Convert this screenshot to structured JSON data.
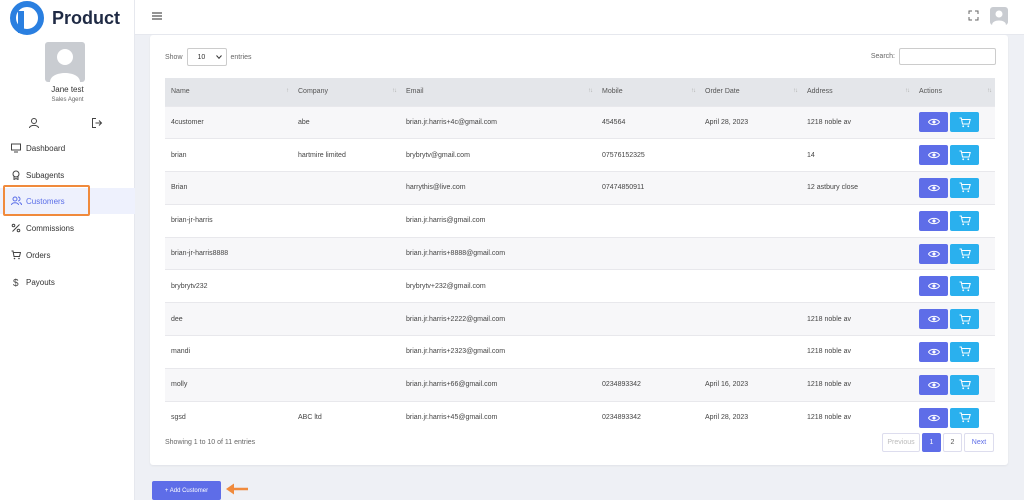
{
  "brand": {
    "name": "Product",
    "color": "#2a7fe0"
  },
  "user": {
    "name": "Jane test",
    "role": "Sales Agent"
  },
  "nav": [
    {
      "label": "Dashboard",
      "icon": "monitor-icon"
    },
    {
      "label": "Subagents",
      "icon": "badge-icon"
    },
    {
      "label": "Customers",
      "icon": "users-icon",
      "active": true
    },
    {
      "label": "Commissions",
      "icon": "percent-icon"
    },
    {
      "label": "Orders",
      "icon": "cart-icon"
    },
    {
      "label": "Payouts",
      "icon": "dollar-icon"
    }
  ],
  "controls": {
    "show_label": "Show",
    "page_length": "10",
    "entries_label": "entries",
    "search_label": "Search:",
    "search_value": ""
  },
  "table": {
    "columns": [
      "Name",
      "Company",
      "Email",
      "Mobile",
      "Order Date",
      "Address",
      "Actions"
    ],
    "rows": [
      [
        "4customer",
        "abe",
        "brian.jr.harris+4c@gmail.com",
        "454564",
        "April 28, 2023",
        "1218 noble av"
      ],
      [
        "brian",
        "hartmire limited",
        "brybrytv@gmail.com",
        "07576152325",
        "",
        "14"
      ],
      [
        "Brian",
        "",
        "harrythis@live.com",
        "07474850911",
        "",
        "12 astbury close"
      ],
      [
        "brian-jr-harris",
        "",
        "brian.jr.harris@gmail.com",
        "",
        "",
        ""
      ],
      [
        "brian-jr-harris8888",
        "",
        "brian.jr.harris+8888@gmail.com",
        "",
        "",
        ""
      ],
      [
        "brybrytv232",
        "",
        "brybrytv+232@gmail.com",
        "",
        "",
        ""
      ],
      [
        "dee",
        "",
        "brian.jr.harris+2222@gmail.com",
        "",
        "",
        "1218 noble av"
      ],
      [
        "mandi",
        "",
        "brian.jr.harris+2323@gmail.com",
        "",
        "",
        "1218 noble av"
      ],
      [
        "molly",
        "",
        "brian.jr.harris+66@gmail.com",
        "0234893342",
        "April 16, 2023",
        "1218 noble av"
      ],
      [
        "sgsd",
        "ABC ltd",
        "brian.jr.harris+45@gmail.com",
        "0234893342",
        "April 28, 2023",
        "1218 noble av"
      ]
    ]
  },
  "info": "Showing 1 to 10 of 11 entries",
  "pagination": {
    "previous": "Previous",
    "pages": [
      "1",
      "2"
    ],
    "current": "1",
    "next": "Next"
  },
  "add_button": "+ Add Customer",
  "colors": {
    "primary": "#5e6de8",
    "cart": "#2ab0ee",
    "highlight": "#f08a3c"
  }
}
